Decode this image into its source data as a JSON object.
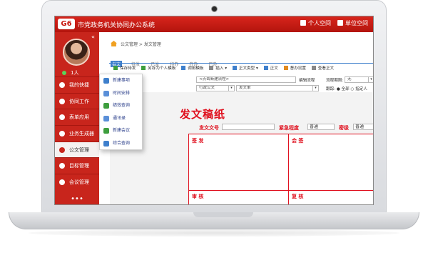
{
  "app": {
    "logo": "G6",
    "title": "市党政务机关协同办公系统",
    "buttons": [
      {
        "label": "个人空间",
        "icon": "user-icon"
      },
      {
        "label": "单位空间",
        "icon": "building-icon"
      }
    ]
  },
  "sidebar": {
    "collapse_glyph": "«",
    "user_label": "1人",
    "more_glyph": "•••",
    "items": [
      {
        "label": "我的快捷",
        "icon": "plus-icon"
      },
      {
        "label": "协同工作",
        "icon": "share-icon"
      },
      {
        "label": "表单应用",
        "icon": "form-icon"
      },
      {
        "label": "业务生成器",
        "icon": "home-icon"
      },
      {
        "label": "公文管理",
        "icon": "document-icon"
      },
      {
        "label": "目标管理",
        "icon": "target-icon"
      },
      {
        "label": "会议管理",
        "icon": "meeting-icon"
      }
    ]
  },
  "breadcrumb": "公文管理 > 发文管理",
  "tabs": [
    "拟文",
    "待发",
    "已发",
    "待办",
    "在办",
    "已办"
  ],
  "toolbar": [
    "保存待发",
    "另存为个人模板",
    "调用模板",
    "插入 ▾",
    "正文类型 ▾",
    "正文",
    "督办设置",
    "查看正文"
  ],
  "form": {
    "flow_placeholder": "<点击新建流程>",
    "edit_flow": "编辑流程",
    "deadline_label": "流程期限:",
    "deadline_value": "无",
    "type_value": "行政公文",
    "doc_value": "发文单",
    "trace_label": "跟踪:",
    "trace_all": "全部",
    "trace_specified": "指定人"
  },
  "document": {
    "title": "发文稿纸",
    "number_label": "发文文号",
    "urgency_label": "紧急程度",
    "urgency_value": "普通",
    "secret_label": "密级",
    "secret_value": "普通",
    "cells": {
      "sign": "签 发",
      "countersign": "会 签",
      "review": "审 核",
      "check": "复 核"
    }
  },
  "popup": {
    "items": [
      {
        "label": "新建事项",
        "icon": "new-item-icon"
      },
      {
        "label": "时间安排",
        "icon": "schedule-icon"
      },
      {
        "label": "绩效查询",
        "icon": "performance-icon"
      },
      {
        "label": "通讯录",
        "icon": "contacts-icon"
      },
      {
        "label": "新建会议",
        "icon": "new-meeting-icon"
      },
      {
        "label": "综合查询",
        "icon": "query-icon"
      }
    ]
  }
}
